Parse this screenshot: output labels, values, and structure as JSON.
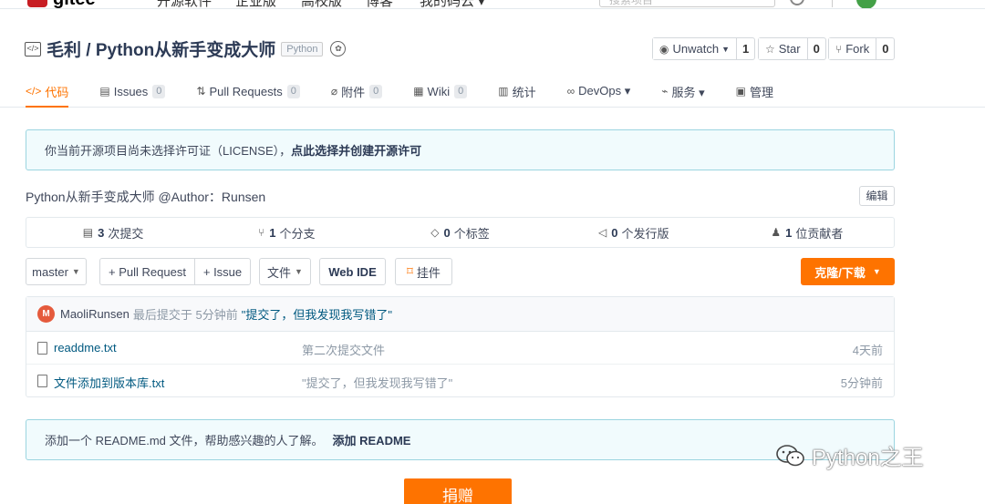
{
  "topbar": {
    "logo_text": "gitee",
    "nav": [
      "开源软件",
      "企业版",
      "高校版",
      "博客",
      "我的码云 ▾"
    ],
    "search_placeholder": "搜索项目"
  },
  "repo": {
    "owner_and_name": "毛利 / Python从新手变成大师",
    "language": "Python"
  },
  "actions": {
    "watch_label": "Unwatch",
    "watch_count": "1",
    "star_label": "Star",
    "star_count": "0",
    "fork_label": "Fork",
    "fork_count": "0"
  },
  "tabs": [
    {
      "label": "代码"
    },
    {
      "label": "Issues",
      "count": "0"
    },
    {
      "label": "Pull Requests",
      "count": "0"
    },
    {
      "label": "附件",
      "count": "0"
    },
    {
      "label": "Wiki",
      "count": "0"
    },
    {
      "label": "统计"
    },
    {
      "label": "DevOps ▾"
    },
    {
      "label": "服务 ▾"
    },
    {
      "label": "管理"
    }
  ],
  "license_notice": {
    "text": "你当前开源项目尚未选择许可证（LICENSE），",
    "link": "点此选择并创建开源许可"
  },
  "description": "Python从新手变成大师 @Author：Runsen",
  "edit_label": "编辑",
  "stats": [
    {
      "num": "3",
      "label": "次提交"
    },
    {
      "num": "1",
      "label": "个分支"
    },
    {
      "num": "0",
      "label": "个标签"
    },
    {
      "num": "0",
      "label": "个发行版"
    },
    {
      "num": "1",
      "label": "位贡献者"
    }
  ],
  "toolbar": {
    "branch": "master",
    "pull_request": "+ Pull Request",
    "issue": "+ Issue",
    "file": "文件",
    "web_ide": "Web IDE",
    "widget": "挂件",
    "clone": "克隆/下载"
  },
  "commit": {
    "avatar_letter": "M",
    "user": "MaoliRunsen",
    "meta": "最后提交于 5分钟前",
    "message": "\"提交了，但我发现我写错了\""
  },
  "files": [
    {
      "name": "readdme.txt",
      "message": "第二次提交文件",
      "time": "4天前"
    },
    {
      "name": "文件添加到版本库.txt",
      "message": "\"提交了，但我发现我写错了\"",
      "time": "5分钟前"
    }
  ],
  "readme_notice": {
    "text": "添加一个 README.md 文件，帮助感兴趣的人了解。",
    "link": "添加 README"
  },
  "donate_label": "捐赠",
  "watermark": "Python之王"
}
